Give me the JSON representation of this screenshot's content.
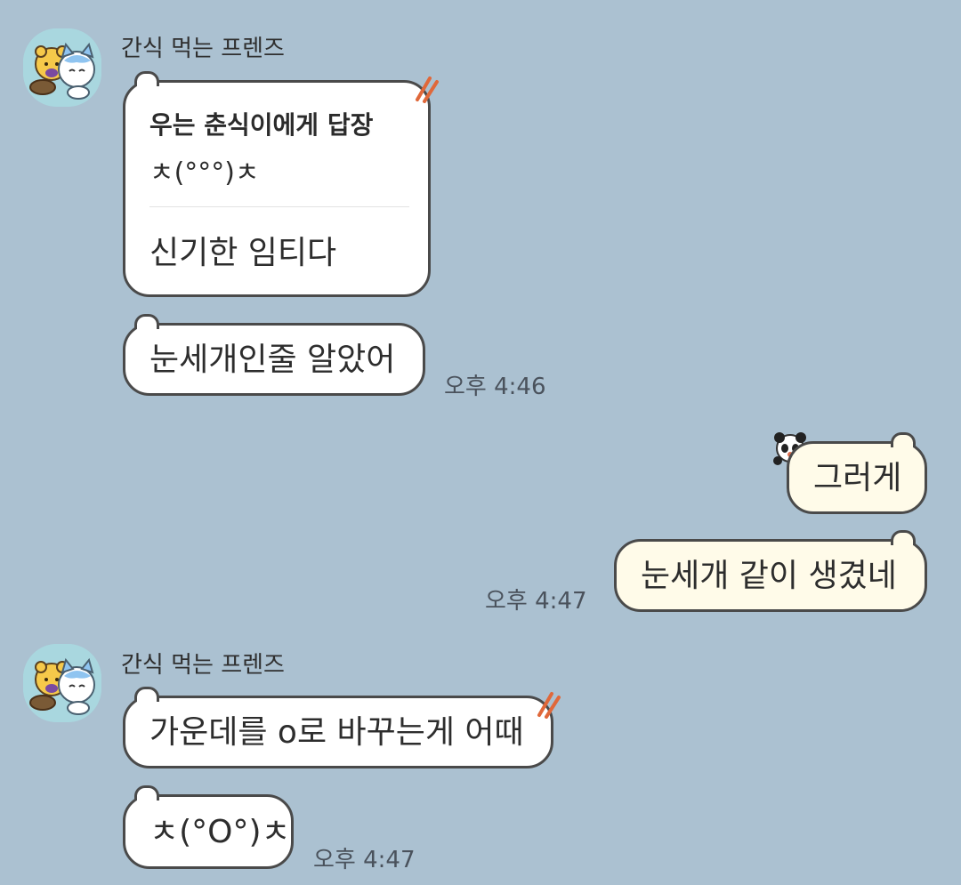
{
  "background_color": "#abc1d1",
  "messages": [
    {
      "sender": "간식 먹는 프렌즈",
      "avatar_icon": "bear-and-cat-avatar-icon",
      "reply": {
        "title": "우는 춘식이에게 답장",
        "quote": "ㅊ(°°°)ㅊ",
        "text": "신기한 임티다"
      },
      "text_2": "눈세개인줄 알았어",
      "time": "오후 4:46"
    },
    {
      "mine": true,
      "text_1": "그러게",
      "text_2": "눈세개 같이 생겼네",
      "time": "오후 4:47"
    },
    {
      "sender": "간식 먹는 프렌즈",
      "avatar_icon": "bear-and-cat-avatar-icon",
      "text_1": "가운데를 o로 바꾸는게 어때",
      "text_2": "ㅊ(°O°)ㅊ",
      "time": "오후 4:47"
    }
  ]
}
